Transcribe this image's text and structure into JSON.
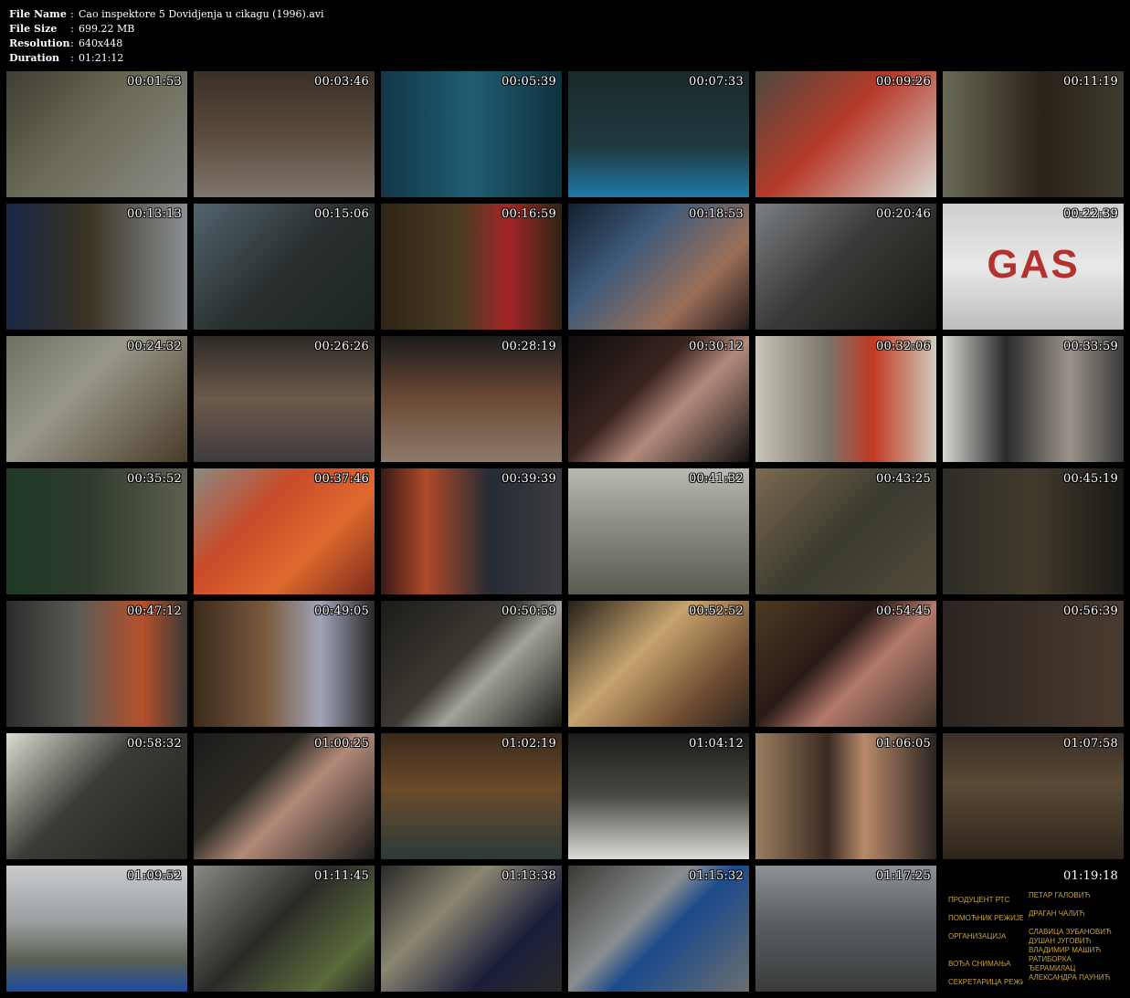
{
  "file_info": {
    "file_name_label": "File Name",
    "file_name_value": "Cao inspektore 5 Dovidjenja u cikagu (1996).avi",
    "file_size_label": "File Size",
    "file_size_value": "699.22 MB",
    "resolution_label": "Resolution",
    "resolution_value": "640x448",
    "duration_label": "Duration",
    "duration_value": "01:21:12",
    "separator": ":"
  },
  "thumbnails": [
    {
      "time": "00:01:53",
      "bg": "linear-gradient(135deg,#3f3d32 0%,#6b6a56 45%,#8a8b86 100%)"
    },
    {
      "time": "00:03:46",
      "bg": "linear-gradient(180deg,#3a3027 0%,#5a4a3d 50%,#7e766c 100%)"
    },
    {
      "time": "00:05:39",
      "bg": "linear-gradient(90deg,#123748 0%,#1f5d72 50%,#10323f 100%)"
    },
    {
      "time": "00:07:33",
      "bg": "linear-gradient(180deg,#1b2a2a 0%,#1f3a3f 60%,#1f78a8 100%)"
    },
    {
      "time": "00:09:26",
      "bg": "linear-gradient(135deg,#4d4a3e 0%,#b63a2a 45%,#d9d9d0 100%)"
    },
    {
      "time": "00:11:19",
      "bg": "linear-gradient(90deg,#6a6a58 0%,#2a2118 55%,#3d3b2d 100%)"
    },
    {
      "time": "00:13:13",
      "bg": "linear-gradient(90deg,#1a2745 0%,#3a3324 45%,#8b8f93 100%)"
    },
    {
      "time": "00:15:06",
      "bg": "linear-gradient(135deg,#52646c 0%,#2a3030 50%,#1d2424 100%)"
    },
    {
      "time": "00:16:59",
      "bg": "linear-gradient(90deg,#2f2516 0%,#4a3b22 45%,#a32525 70%,#2f2516 100%)"
    },
    {
      "time": "00:18:53",
      "bg": "linear-gradient(135deg,#12202e 0%,#3e5a7a 35%,#9b6f59 70%,#241a1a 100%)"
    },
    {
      "time": "00:20:46",
      "bg": "linear-gradient(135deg,#7b7f84 0%,#3b3a38 45%,#1b1916 100%)"
    },
    {
      "time": "00:22:39",
      "bg": "linear-gradient(180deg,#cfcfcf 0%,#e8e8e8 50%,#bdbdbd 100%)",
      "text": "GAS",
      "text_color": "#b3322e"
    },
    {
      "time": "00:24:32",
      "bg": "linear-gradient(135deg,#6f6f62 0%,#98988a 40%,#4a3b2a 100%)"
    },
    {
      "time": "00:26:26",
      "bg": "linear-gradient(180deg,#2e2a26 0%,#6c5a4a 50%,#3e3b40 100%)"
    },
    {
      "time": "00:28:19",
      "bg": "linear-gradient(180deg,#1c1c1c 0%,#6c4a36 50%,#8d7a6a 100%)"
    },
    {
      "time": "00:30:12",
      "bg": "linear-gradient(135deg,#0d0d0d 0%,#3a2420 40%,#b38a7a 60%,#121212 100%)"
    },
    {
      "time": "00:32:06",
      "bg": "linear-gradient(90deg,#c8c4b8 0%,#7a746a 40%,#c13a22 65%,#d0cbc0 100%)"
    },
    {
      "time": "00:33:59",
      "bg": "linear-gradient(90deg,#d7d7d2 0%,#2b2b2b 35%,#9a948a 70%,#3a3a3a 100%)"
    },
    {
      "time": "00:35:52",
      "bg": "linear-gradient(90deg,#1f3a27 0%,#2f3a2c 45%,#5c5f4e 100%)"
    },
    {
      "time": "00:37:46",
      "bg": "linear-gradient(135deg,#8a8a80 0%,#c84b2a 35%,#e06a2e 65%,#7a2b1c 100%)"
    },
    {
      "time": "00:39:39",
      "bg": "linear-gradient(90deg,#3a1a16 0%,#b04a2a 25%,#262b34 60%,#3c3c40 100%)"
    },
    {
      "time": "00:41:32",
      "bg": "linear-gradient(180deg,#b9b9b2 0%,#8c8c82 45%,#5a5a50 100%)"
    },
    {
      "time": "00:43:25",
      "bg": "linear-gradient(135deg,#7b6a50 0%,#3a3a2f 50%,#514a3a 100%)"
    },
    {
      "time": "00:45:19",
      "bg": "linear-gradient(90deg,#2d2d26 0%,#423a2c 50%,#1b1a16 100%)"
    },
    {
      "time": "00:47:12",
      "bg": "linear-gradient(90deg,#2b2b2b 0%,#5b5b55 40%,#b5502b 75%,#3a3a36 100%)"
    },
    {
      "time": "00:49:05",
      "bg": "linear-gradient(90deg,#3b2a1c 0%,#7a5a3e 40%,#a0a4b8 70%,#2a2a2a 100%)"
    },
    {
      "time": "00:50:59",
      "bg": "linear-gradient(135deg,#1d1b16 0%,#3c3a33 45%,#a2a29a 60%,#181612 100%)"
    },
    {
      "time": "00:52:52",
      "bg": "linear-gradient(135deg,#242018 0%,#c7a36e 40%,#6c4a2e 75%,#2a2520 100%)"
    },
    {
      "time": "00:54:45",
      "bg": "linear-gradient(135deg,#4a3a22 0%,#2a1a16 40%,#b37a6a 60%,#3a3026 100%)"
    },
    {
      "time": "00:56:39",
      "bg": "linear-gradient(90deg,#2b2420 0%,#3a3028 50%,#4a3a2e 100%)"
    },
    {
      "time": "00:58:32",
      "bg": "linear-gradient(135deg,#dcdcd2 0%,#3b3b36 45%,#24221f 100%)"
    },
    {
      "time": "01:00:25",
      "bg": "linear-gradient(135deg,#1a1c1a 0%,#2e2a24 35%,#b28a78 55%,#1c1c1a 100%)"
    },
    {
      "time": "01:02:19",
      "bg": "linear-gradient(180deg,#3a2a1a 0%,#6a4a2a 45%,#2a3a3a 100%)"
    },
    {
      "time": "01:04:12",
      "bg": "linear-gradient(180deg,#1c1c1a 0%,#4a4a44 50%,#dcdcd6 100%)"
    },
    {
      "time": "01:06:05",
      "bg": "linear-gradient(90deg,#9a7e5e 0%,#3a2a22 40%,#b88a6a 60%,#2a2420 100%)"
    },
    {
      "time": "01:07:58",
      "bg": "linear-gradient(180deg,#3a2e26 0%,#5a4a36 40%,#2e251c 100%)"
    },
    {
      "time": "01:09:52",
      "bg": "linear-gradient(180deg,#c9cbcd 0%,#9a9ea0 45%,#5a6050 75%,#1d4aa0 100%)"
    },
    {
      "time": "01:11:45",
      "bg": "linear-gradient(135deg,#8a8a84 0%,#2a2a28 45%,#5a6a3a 80%,#222 100%)"
    },
    {
      "time": "01:13:38",
      "bg": "linear-gradient(135deg,#2a2a28 0%,#8a8670 35%,#1a1e3a 70%,#2a2a28 100%)"
    },
    {
      "time": "01:15:32",
      "bg": "linear-gradient(135deg,#3a3a34 0%,#8a8e90 40%,#1a4a8a 55%,#6a6e70 100%)"
    },
    {
      "time": "01:17:25",
      "bg": "linear-gradient(180deg,#8e9296 0%,#5a5e60 45%,#3a3c3c 100%)"
    },
    {
      "time": "01:19:18",
      "bg": "#000000",
      "credits": [
        {
          "role": "ПРОДУЦЕНТ РТС",
          "name": "ПЕТАР ГАЛОВИЋ"
        },
        {
          "role": "ПОМОЋНИК РЕЖИЈЕ",
          "name": "ДРАГАН ЧАЛИЋ"
        },
        {
          "role": "ОРГАНИЗАЦИЈА",
          "name": "СЛАВИЦА ЗУБАНОВИЋ\nДУШАН ЈУГОВИЋ\nВЛАДИМИР МАШИЋ"
        },
        {
          "role": "ВОЂА СНИМАЊА",
          "name": "РАТИБОРКА ЂЕРАМИЛАЦ"
        },
        {
          "role": "СЕКРЕТАРИЦА РЕЖИЈЕ",
          "name": "АЛЕКСАНДРА ПАУНИЋ"
        }
      ]
    }
  ]
}
